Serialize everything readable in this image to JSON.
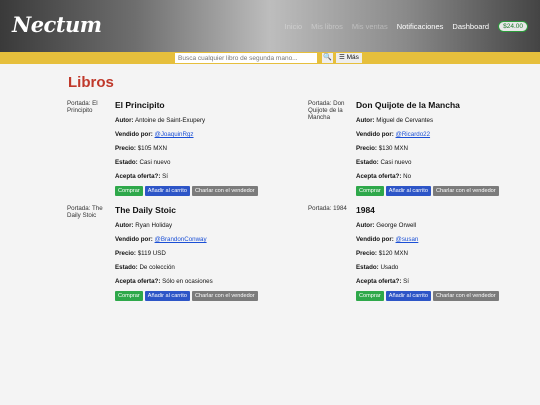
{
  "header": {
    "logo": "Nectum",
    "nav": [
      {
        "label": "Inicio",
        "faint": true
      },
      {
        "label": "Mis libros",
        "faint": true
      },
      {
        "label": "Mis ventas",
        "faint": true
      },
      {
        "label": "Notificaciones",
        "faint": false
      },
      {
        "label": "Dashboard",
        "faint": false
      }
    ],
    "balance": "$24.00"
  },
  "search": {
    "placeholder": "Busca cualquier libro de segunda mano...",
    "search_icon": "magnifier-icon",
    "more_label": "☰ Más"
  },
  "page": {
    "title": "Libros"
  },
  "labels": {
    "author": "Autor:",
    "seller": "Vendido por:",
    "price": "Precio:",
    "condition": "Estado:",
    "offers": "Acepta oferta?:",
    "buy": "Comprar",
    "cart": "Añadir al carrito",
    "chat": "Charlar con el vendedor"
  },
  "books": [
    {
      "cover_alt": "Portada: El Principito",
      "title": "El Principito",
      "author": "Antoine de Saint-Exupery",
      "seller": "@JoaquinRgz",
      "price": "$105 MXN",
      "condition": "Casi nuevo",
      "offers": "Sí"
    },
    {
      "cover_alt": "Portada: Don Quijote de la Mancha",
      "title": "Don Quijote de la Mancha",
      "author": "Miguel de Cervantes",
      "seller": "@Ricardo22",
      "price": "$130 MXN",
      "condition": "Casi nuevo",
      "offers": "No"
    },
    {
      "cover_alt": "Portada: The Daily Stoic",
      "title": "The Daily Stoic",
      "author": "Ryan Holiday",
      "seller": "@BrandonConway",
      "price": "$119 USD",
      "condition": "De colección",
      "offers": "Sólo en ocasiones"
    },
    {
      "cover_alt": "Portada: 1984",
      "title": "1984",
      "author": "George Orwell",
      "seller": "@susan",
      "price": "$120 MXN",
      "condition": "Usado",
      "offers": "Sí"
    }
  ]
}
